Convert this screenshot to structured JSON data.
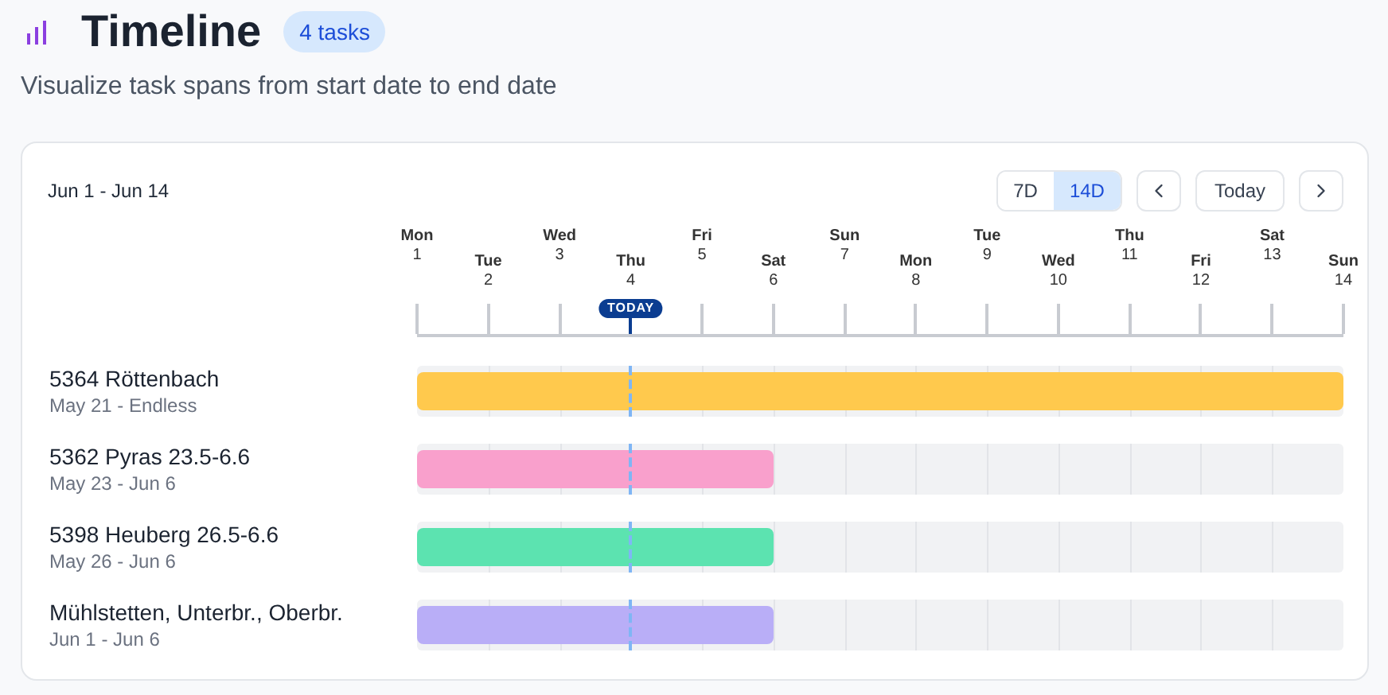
{
  "header": {
    "title": "Timeline",
    "badge": "4 tasks",
    "subtitle": "Visualize task spans from start date to end date"
  },
  "toolbar": {
    "range": "Jun 1 - Jun 14",
    "zoom": [
      {
        "label": "7D",
        "selected": false
      },
      {
        "label": "14D",
        "selected": true
      }
    ],
    "today_button": "Today"
  },
  "today_label": "TODAY",
  "days": [
    {
      "weekday": "Mon",
      "day": "1",
      "today": false
    },
    {
      "weekday": "Tue",
      "day": "2",
      "today": false
    },
    {
      "weekday": "Wed",
      "day": "3",
      "today": false
    },
    {
      "weekday": "Thu",
      "day": "4",
      "today": true
    },
    {
      "weekday": "Fri",
      "day": "5",
      "today": false
    },
    {
      "weekday": "Sat",
      "day": "6",
      "today": false
    },
    {
      "weekday": "Sun",
      "day": "7",
      "today": false
    },
    {
      "weekday": "Mon",
      "day": "8",
      "today": false
    },
    {
      "weekday": "Tue",
      "day": "9",
      "today": false
    },
    {
      "weekday": "Wed",
      "day": "10",
      "today": false
    },
    {
      "weekday": "Thu",
      "day": "11",
      "today": false
    },
    {
      "weekday": "Fri",
      "day": "12",
      "today": false
    },
    {
      "weekday": "Sat",
      "day": "13",
      "today": false
    },
    {
      "weekday": "Sun",
      "day": "14",
      "today": false
    }
  ],
  "tasks": [
    {
      "name": "5364 Röttenbach",
      "dates": "May 21 - Endless",
      "color": "#ffc94d",
      "level": 1
    },
    {
      "name": "5362 Pyras 23.5-6.6",
      "dates": "May 23 - Jun 6",
      "color": "#f9a0cc",
      "level": 0.385
    },
    {
      "name": "5398 Heuberg 26.5-6.6",
      "dates": "May 26 - Jun 6",
      "color": "#5ce3b0",
      "level": 0.385
    },
    {
      "name": "Mühlstetten, Unterbr., Oberbr.",
      "dates": "Jun 1 - Jun 6",
      "color": "#b9aef7",
      "level": 0.385
    }
  ]
}
